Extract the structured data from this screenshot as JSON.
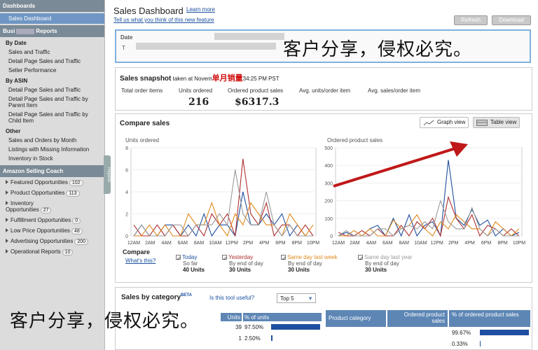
{
  "sidebar": {
    "header_dashboards": "Dashboards",
    "selected": "Sales Dashboard",
    "header_reports_pre": "Busi",
    "header_reports_post": "Reports",
    "by_date_label": "By Date",
    "by_date_items": [
      "Sales and Traffic",
      "Detail Page Sales and Traffic",
      "Seller Performance"
    ],
    "by_asin_label": "By ASIN",
    "by_asin_items": [
      "Detail Page Sales and Traffic",
      "Detail Page Sales and Traffic by Parent Item",
      "Detail Page Sales and Traffic by Child Item"
    ],
    "other_label": "Other",
    "other_items": [
      "Sales and Orders by Month",
      "Listings with Missing Information",
      "Inventory in Stock"
    ],
    "coach_header": "Amazon Selling Coach",
    "opportunities": [
      {
        "label": "Featured Opportunities",
        "count": "102"
      },
      {
        "label": "Product Opportunities",
        "count": "113"
      },
      {
        "label": "Inventory Opportunities",
        "count": "27"
      },
      {
        "label": "Fulfillment Opportunities",
        "count": "0"
      },
      {
        "label": "Low Price Opportunities",
        "count": "48"
      },
      {
        "label": "Advertising Opportunities",
        "count": "200"
      },
      {
        "label": "Operational Reports",
        "count": "10"
      }
    ],
    "collapse_tab": "Reports"
  },
  "header": {
    "title": "Sales Dashboard",
    "learn_more": "Learn more",
    "feedback_link": "Tell us what you think of this new feature",
    "refresh": "Refresh",
    "download": "Download"
  },
  "date_panel": {
    "label": "Date",
    "sub": "T"
  },
  "watermark": "客户分享，侵权必究。",
  "snapshot": {
    "title": "Sales snapshot",
    "taken_at": "taken at Novem",
    "annotation": "单月销量",
    "time": "34:25 PM PST",
    "metrics": [
      {
        "label": "Total order items",
        "value": ""
      },
      {
        "label": "Units ordered",
        "value": "216"
      },
      {
        "label": "Ordered product sales",
        "value": "$6317.3"
      },
      {
        "label": "Avg. units/order item",
        "value": ""
      },
      {
        "label": "Avg. sales/order item",
        "value": ""
      }
    ]
  },
  "compare": {
    "title": "Compare sales",
    "graph_view": "Graph view",
    "table_view": "Table view",
    "compare_label": "Compare",
    "whats_this": "What's this?",
    "legend": [
      {
        "name": "Today",
        "sub": "So far",
        "value": "40 Units",
        "color": "#1f4fa0",
        "checked": true
      },
      {
        "name": "Yesterday",
        "sub": "By end of day",
        "value": "30 Units",
        "color": "#b03030",
        "checked": true
      },
      {
        "name": "Same day last week",
        "sub": "By end of day",
        "value": "30 Units",
        "color": "#e08a1e",
        "checked": true
      },
      {
        "name": "Same day last year",
        "sub": "By end of day",
        "value": "30 Units",
        "color": "#9a9a9a",
        "checked": true
      }
    ]
  },
  "category": {
    "title": "Sales by category",
    "beta": "BETA",
    "useful": "Is this tool useful?",
    "select": "Top 5",
    "left_headers": [
      "Units",
      "% of units"
    ],
    "left_rows": [
      {
        "units": "39",
        "pct": "97.50%",
        "frac": 0.975
      },
      {
        "units": "1",
        "pct": "2.50%",
        "frac": 0.025
      }
    ],
    "right_headers": [
      "Product category",
      "Ordered product sales",
      "% of ordered product sales"
    ],
    "right_rows": [
      {
        "pct": "99.67%",
        "frac": 0.9967
      },
      {
        "pct": "0.33%",
        "frac": 0.0033
      }
    ]
  },
  "chart_data": [
    {
      "type": "line",
      "title": "Units ordered",
      "categories": [
        "12AM",
        "2AM",
        "4AM",
        "6AM",
        "8AM",
        "10AM",
        "12PM",
        "2PM",
        "4PM",
        "6PM",
        "8PM",
        "10PM"
      ],
      "ylim": [
        0,
        8
      ],
      "yticks": [
        0,
        2,
        4,
        6,
        8
      ],
      "series": [
        {
          "name": "Today",
          "color": "#1f4fa0",
          "values": [
            0,
            1,
            0,
            0,
            1,
            1,
            0,
            1,
            0,
            2,
            0,
            1,
            1,
            0,
            4,
            1,
            1,
            2,
            1,
            2,
            0,
            1,
            0,
            0
          ]
        },
        {
          "name": "Yesterday",
          "color": "#b03030",
          "values": [
            1,
            0,
            0,
            1,
            0,
            1,
            0,
            0,
            1,
            0,
            2,
            1,
            2,
            0,
            7,
            2,
            1,
            3,
            0,
            1,
            1,
            0,
            1,
            0
          ]
        },
        {
          "name": "Same day last week",
          "color": "#e08a1e",
          "values": [
            0,
            0,
            1,
            0,
            1,
            0,
            0,
            2,
            1,
            1,
            3,
            1,
            0,
            2,
            1,
            3,
            2,
            1,
            1,
            0,
            2,
            1,
            0,
            1
          ]
        },
        {
          "name": "Same day last year",
          "color": "#9a9a9a",
          "values": [
            0,
            1,
            0,
            0,
            0,
            1,
            1,
            0,
            1,
            1,
            1,
            2,
            1,
            6,
            2,
            1,
            1,
            4,
            1,
            0,
            1,
            0,
            0,
            0
          ]
        }
      ]
    },
    {
      "type": "line",
      "title": "Ordered product sales",
      "categories": [
        "12AM",
        "2AM",
        "4AM",
        "6AM",
        "8AM",
        "10AM",
        "12PM",
        "2PM",
        "4PM",
        "6PM",
        "8PM",
        "10PM"
      ],
      "ylim": [
        0,
        500
      ],
      "yticks": [
        0,
        100,
        200,
        300,
        400,
        500
      ],
      "series": [
        {
          "name": "Today",
          "color": "#1f4fa0",
          "values": [
            0,
            20,
            0,
            0,
            40,
            60,
            0,
            100,
            0,
            120,
            0,
            60,
            80,
            0,
            430,
            100,
            60,
            150,
            60,
            90,
            0,
            40,
            0,
            20
          ]
        },
        {
          "name": "Yesterday",
          "color": "#b03030",
          "values": [
            20,
            0,
            0,
            30,
            0,
            40,
            0,
            0,
            60,
            0,
            80,
            40,
            100,
            0,
            220,
            100,
            40,
            120,
            0,
            60,
            40,
            0,
            40,
            0
          ]
        },
        {
          "name": "Same day last week",
          "color": "#e08a1e",
          "values": [
            0,
            0,
            30,
            0,
            40,
            0,
            0,
            90,
            40,
            60,
            120,
            40,
            0,
            80,
            40,
            120,
            80,
            40,
            40,
            0,
            80,
            40,
            0,
            40
          ]
        },
        {
          "name": "Same day last year",
          "color": "#9a9a9a",
          "values": [
            0,
            30,
            0,
            0,
            0,
            40,
            40,
            0,
            40,
            60,
            40,
            80,
            40,
            200,
            80,
            40,
            40,
            160,
            40,
            0,
            40,
            0,
            0,
            0
          ]
        }
      ]
    }
  ]
}
